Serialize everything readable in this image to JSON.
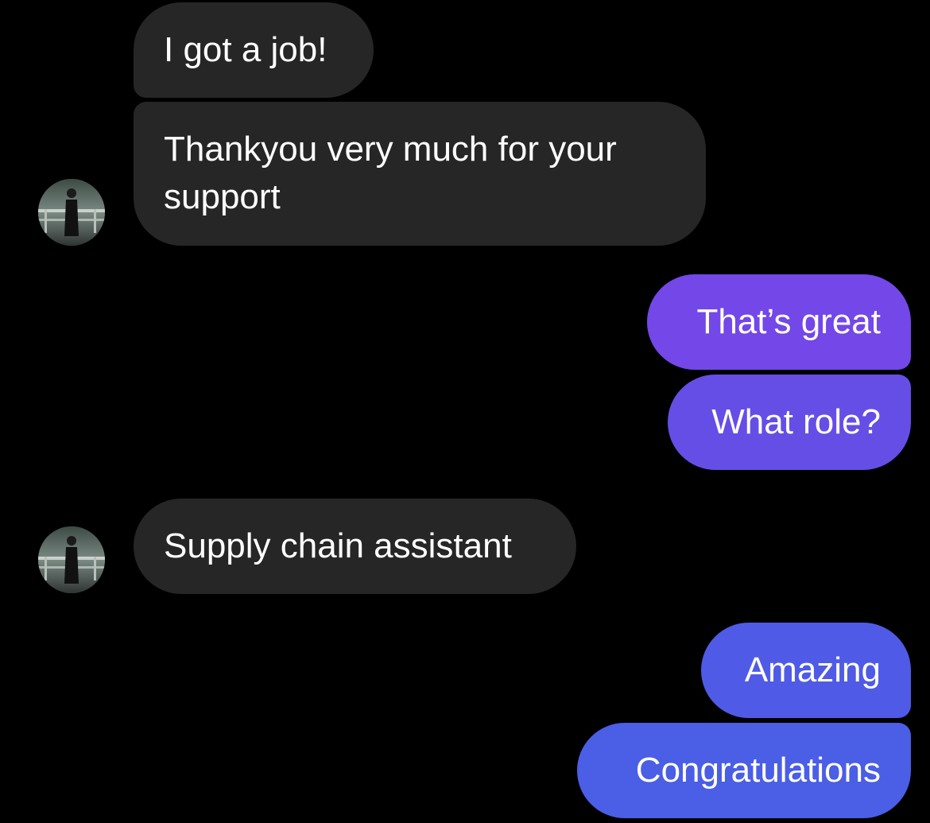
{
  "thread": {
    "incoming": [
      {
        "text": "I got a job!"
      },
      {
        "text": "Thankyou very much for your support"
      },
      {
        "text": "Supply chain assistant"
      }
    ],
    "outgoing": [
      {
        "text": "That’s great"
      },
      {
        "text": "What role?"
      },
      {
        "text": "Amazing"
      },
      {
        "text": "Congratulations"
      }
    ]
  },
  "colors": {
    "background": "#000000",
    "incoming_bubble": "#262626",
    "outgoing_gradient_top": "#7646e8",
    "outgoing_gradient_bottom": "#4a5ce6",
    "text": "#ffffff"
  },
  "avatar": {
    "icon": "contact-photo-avatar"
  }
}
